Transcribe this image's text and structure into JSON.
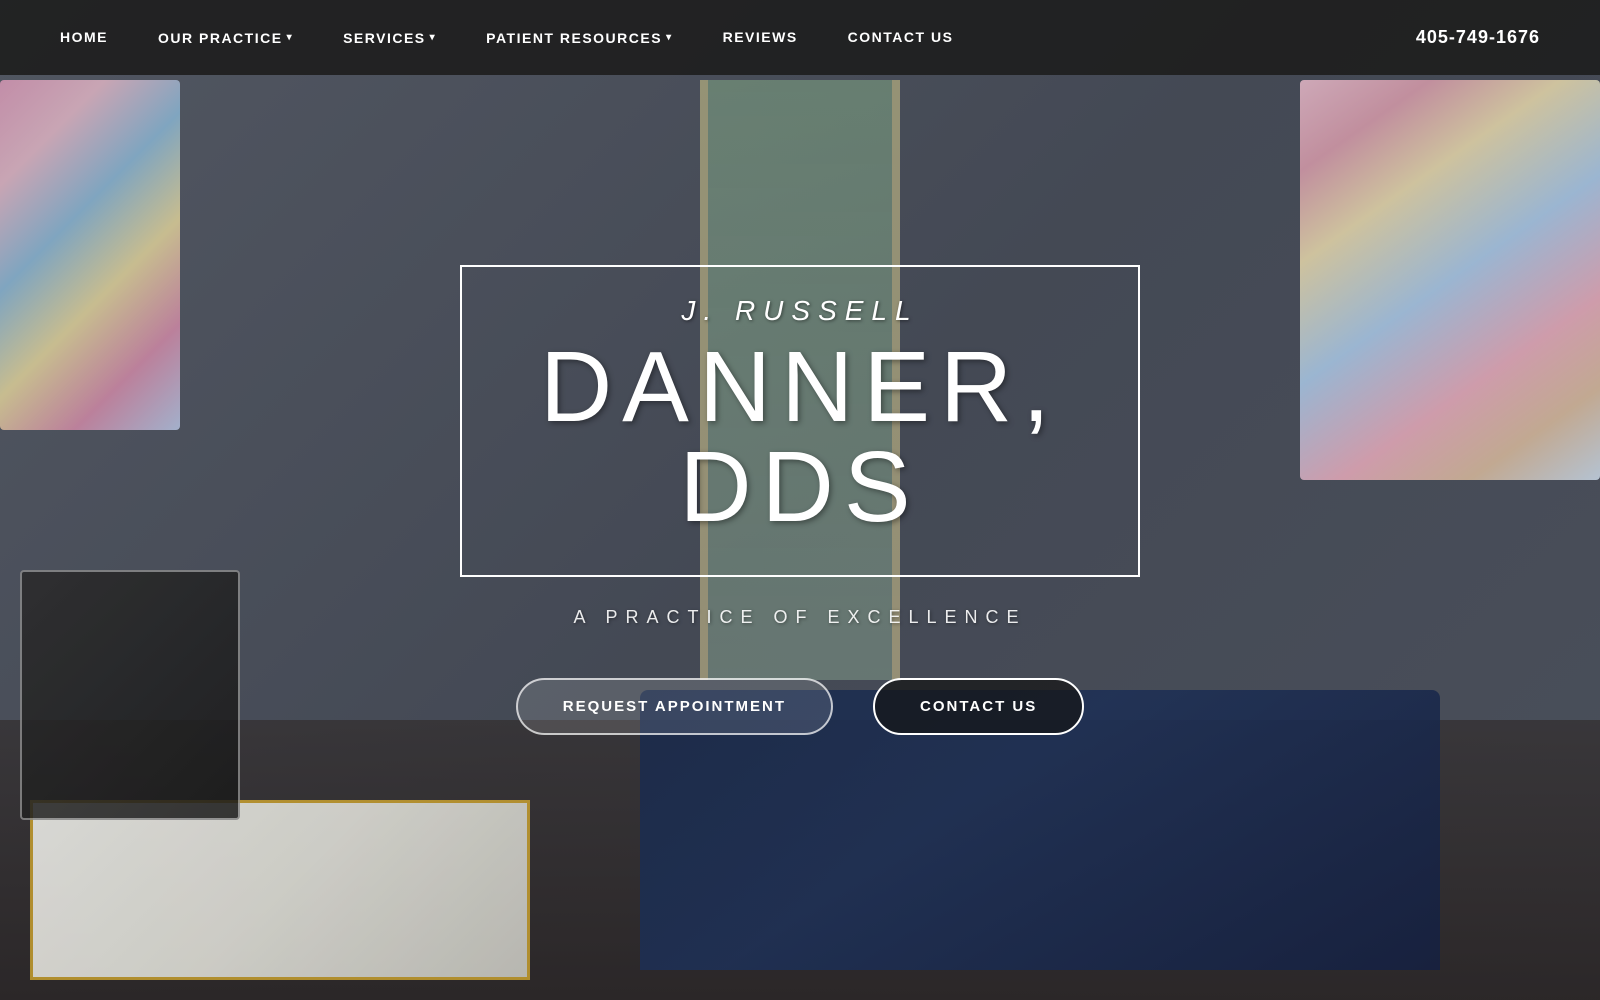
{
  "nav": {
    "links": [
      {
        "id": "home",
        "label": "HOME",
        "hasDropdown": false
      },
      {
        "id": "our-practice",
        "label": "OUR PRACTICE",
        "hasDropdown": true
      },
      {
        "id": "services",
        "label": "SERVICES",
        "hasDropdown": true
      },
      {
        "id": "patient-resources",
        "label": "PATIENT RESOURCES",
        "hasDropdown": true
      },
      {
        "id": "reviews",
        "label": "REVIEWS",
        "hasDropdown": false
      },
      {
        "id": "contact-us",
        "label": "CONTACT US",
        "hasDropdown": false
      }
    ],
    "phone": "405-749-1676"
  },
  "hero": {
    "subtitle": "J. RUSSELL",
    "title": "DANNER, DDS",
    "tagline": "A PRACTICE OF EXCELLENCE",
    "btn_request_label": "REQUEST APPOINTMENT",
    "btn_contact_label": "CONTACT US"
  }
}
